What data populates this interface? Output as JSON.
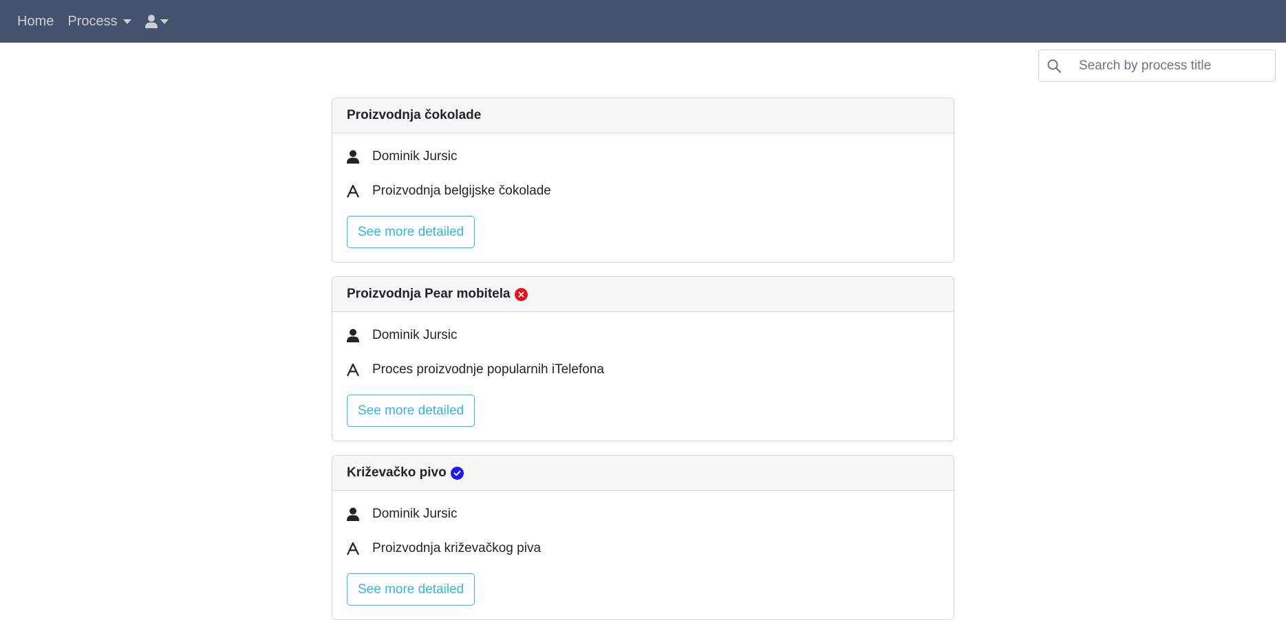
{
  "navbar": {
    "home_label": "Home",
    "process_label": "Process",
    "background": "#45526e"
  },
  "search": {
    "placeholder": "Search by process title",
    "value": ""
  },
  "colors": {
    "button_accent": "#31b8da",
    "status_rejected": "#e3141b",
    "status_approved": "#1c1cf0"
  },
  "processes": [
    {
      "title": "Proizvodnja čokolade",
      "status_icon": "",
      "author": "Dominik Jursic",
      "description": "Proizvodnja belgijske čokolade",
      "button_label": "See more detailed"
    },
    {
      "title": "Proizvodnja Pear mobitela",
      "status_icon": "x-circle-icon",
      "author": "Dominik Jursic",
      "description": "Proces proizvodnje popularnih iTelefona",
      "button_label": "See more detailed"
    },
    {
      "title": "Križevačko pivo",
      "status_icon": "check-circle-icon",
      "author": "Dominik Jursic",
      "description": "Proizvodnja križevačkog piva",
      "button_label": "See more detailed"
    }
  ]
}
